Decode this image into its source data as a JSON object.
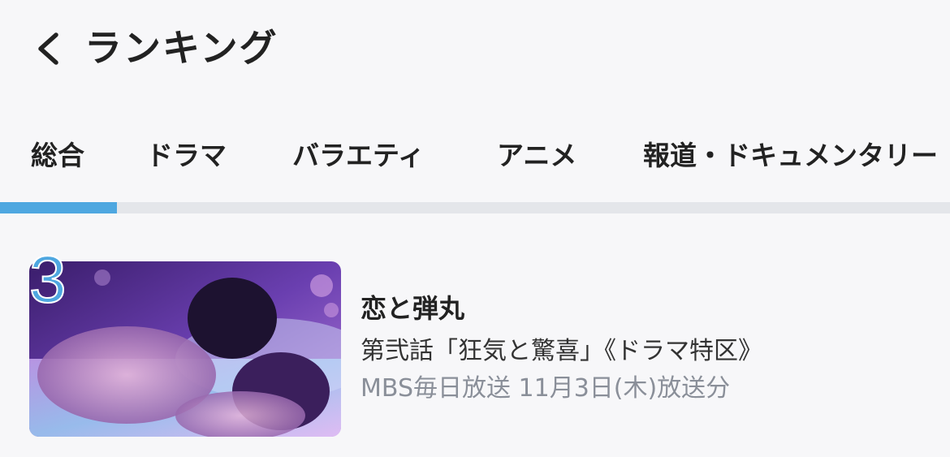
{
  "header": {
    "back_icon": "chevron-left-icon",
    "title": "ランキング"
  },
  "tabs": [
    {
      "label": "総合",
      "active": true
    },
    {
      "label": "ドラマ",
      "active": false
    },
    {
      "label": "バラエティ",
      "active": false
    },
    {
      "label": "アニメ",
      "active": false
    },
    {
      "label": "報道・ドキュメンタリー",
      "active": false
    }
  ],
  "ranking": {
    "items": [
      {
        "rank": "3",
        "title": "恋と弾丸",
        "subtitle": "第弐話「狂気と驚喜」《ドラマ特区》",
        "meta": "MBS毎日放送 11月3日(木)放送分"
      }
    ]
  },
  "colors": {
    "accent": "#4ea7e0",
    "background": "#f7f7f9",
    "track": "#e4e6ea",
    "meta_text": "#8a8f99"
  }
}
